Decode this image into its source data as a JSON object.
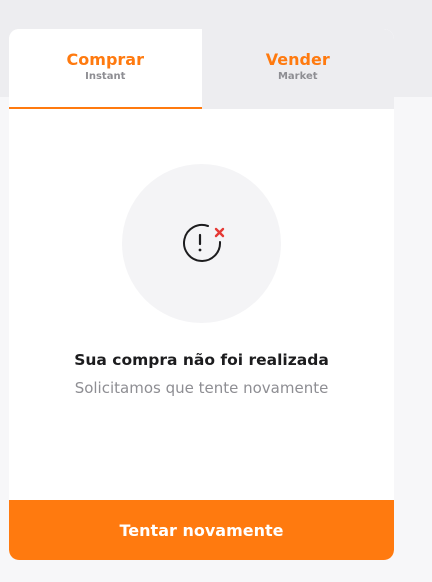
{
  "tabs": {
    "buy": {
      "title": "Comprar",
      "subtitle": "Instant"
    },
    "sell": {
      "title": "Vender",
      "subtitle": "Market"
    }
  },
  "status": {
    "icon": "alert-error-icon",
    "title": "Sua compra não foi realizada",
    "subtitle": "Solicitamos que tente novamente"
  },
  "actions": {
    "retry_label": "Tentar novamente"
  },
  "colors": {
    "accent": "#ff7a0f",
    "error": "#e53935"
  }
}
